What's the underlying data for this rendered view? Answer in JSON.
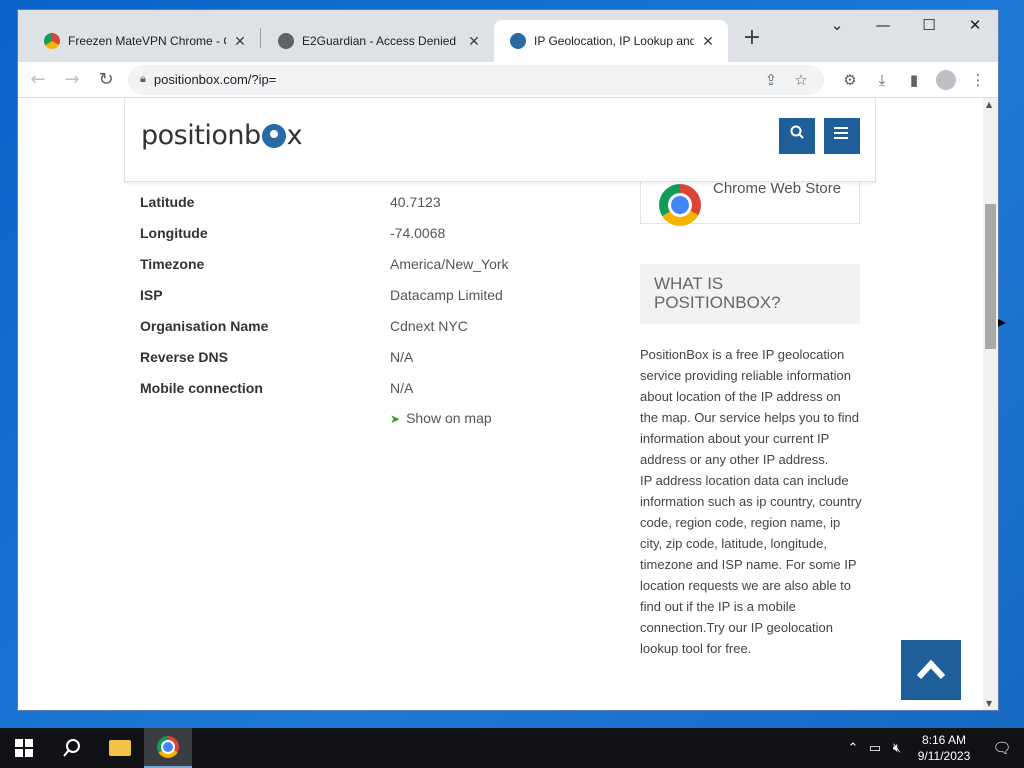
{
  "browser": {
    "tabs": [
      {
        "title": "Freezen MateVPN Chrome - Chr",
        "active": false
      },
      {
        "title": "E2Guardian - Access Denied",
        "active": false
      },
      {
        "title": "IP Geolocation, IP Lookup and R",
        "active": true
      }
    ],
    "url": "positionbox.com/?ip="
  },
  "site": {
    "logo_left": "positionb",
    "logo_right": "x"
  },
  "info": [
    {
      "key": "Latitude",
      "value": "40.7123"
    },
    {
      "key": "Longitude",
      "value": "-74.0068"
    },
    {
      "key": "Timezone",
      "value": "America/New_York"
    },
    {
      "key": "ISP",
      "value": "Datacamp Limited"
    },
    {
      "key": "Organisation Name",
      "value": "Cdnext NYC"
    },
    {
      "key": "Reverse DNS",
      "value": "N/A"
    },
    {
      "key": "Mobile connection",
      "value": "N/A"
    }
  ],
  "show_on_map": "Show on map",
  "sidebar": {
    "cws_label": "Chrome Web Store",
    "what_title_line1": "WHAT IS",
    "what_title_line2": "POSITIONBOX?",
    "desc1": "PositionBox is a free IP geolocation service providing reliable information about location of the IP address on the map. Our service helps you to find information about your current IP address or any other IP address.",
    "desc2": "IP address location data can include information such as ip country, country code, region code, region name, ip city, zip code, latitude, longitude, timezone and ISP name. For some IP location requests we are also able to find out if the IP is a mobile connection.Try our IP geolocation lookup tool for free."
  },
  "taskbar": {
    "time": "8:16 AM",
    "date": "9/11/2023"
  },
  "colors": {
    "brand_blue": "#1e5f99",
    "map_arrow": "#3a9a2e"
  }
}
